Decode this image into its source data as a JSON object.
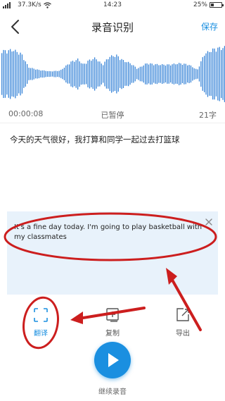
{
  "status_bar": {
    "network": "37.3K/s",
    "time": "14:23",
    "battery": "25%",
    "battery_level": 0.25
  },
  "header": {
    "title": "录音识别",
    "save_label": "保存"
  },
  "recording": {
    "elapsed": "00:00:08",
    "state": "已暂停",
    "char_count": "21字"
  },
  "recognized_text": "今天的天气很好，我打算和同学一起过去打篮球",
  "translation": {
    "text": "It's a fine day today. I'm going to play basketball with my classmates"
  },
  "toolbar": {
    "translate_label": "翻译",
    "copy_label": "复制",
    "export_label": "导出"
  },
  "continue_label": "继续录音",
  "colors": {
    "accent": "#1a8fe0",
    "waveform": "#3a86d8",
    "annotation": "#cc1e1e",
    "translation_bg": "#e8f2fb"
  },
  "icons": {
    "back": "chevron-left-icon",
    "translate": "scan-translate-icon",
    "copy": "copy-icon",
    "export": "export-icon",
    "play": "play-icon",
    "close": "close-icon"
  }
}
